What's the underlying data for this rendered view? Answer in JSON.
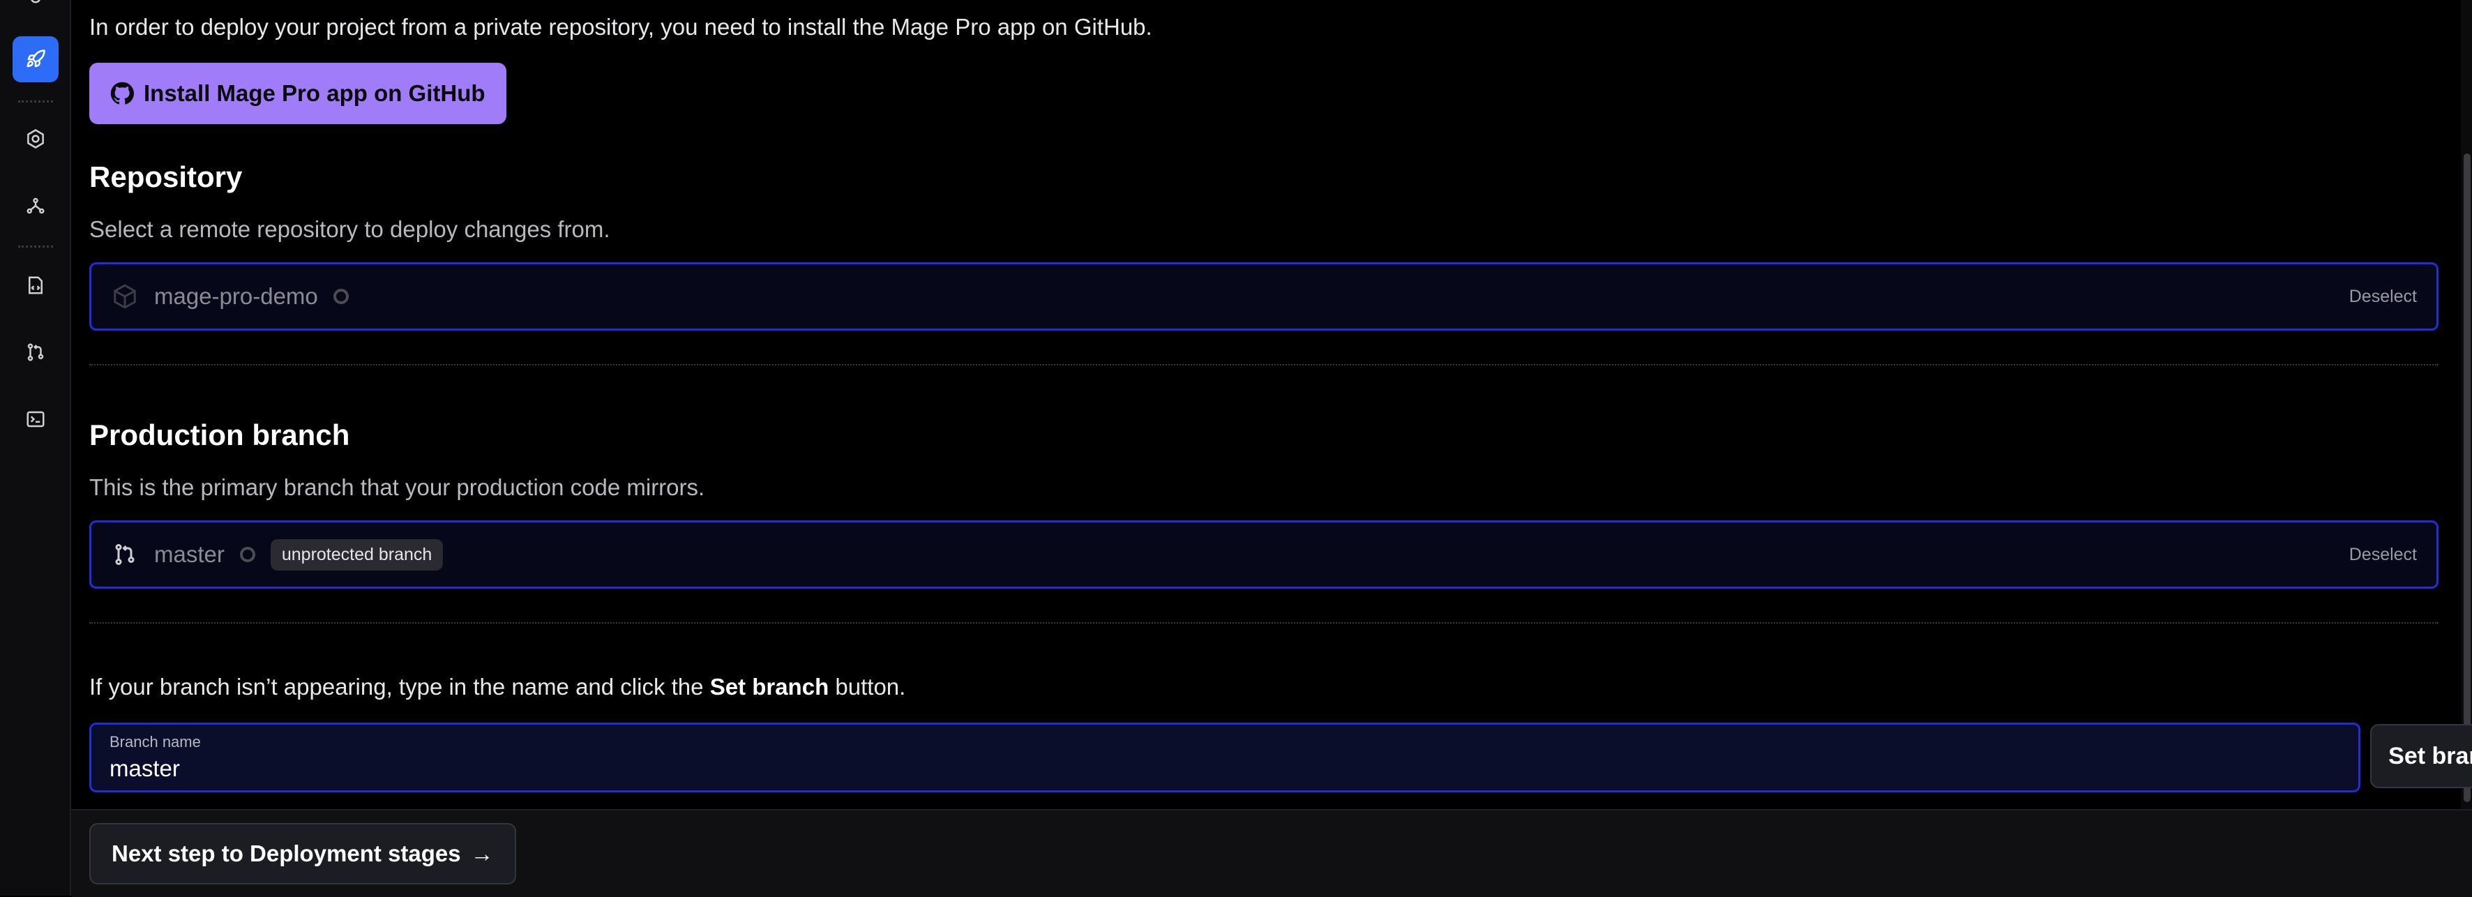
{
  "sidebar": {
    "items": [
      {
        "icon": "rocket-icon",
        "active": true
      },
      {
        "icon": "settings-icon",
        "active": false
      },
      {
        "icon": "nodes-icon",
        "active": false
      },
      {
        "icon": "file-code-icon",
        "active": false
      },
      {
        "icon": "git-branch-icon",
        "active": false
      },
      {
        "icon": "terminal-icon",
        "active": false
      }
    ],
    "accent_color": "#2d6cf6"
  },
  "intro_text": "In order to deploy your project from a private repository, you need to install the Mage Pro app on GitHub.",
  "install_button_label": "Install Mage Pro app on GitHub",
  "repository": {
    "title": "Repository",
    "description": "Select a remote repository to deploy changes from.",
    "selected_name": "mage-pro-demo",
    "deselect_label": "Deselect"
  },
  "production_branch": {
    "title": "Production branch",
    "description": "This is the primary branch that your production code mirrors.",
    "selected_name": "master",
    "badge": "unprotected branch",
    "deselect_label": "Deselect"
  },
  "branch_note": {
    "prefix": "If your branch isn’t appearing, type in the name and click the ",
    "bold": "Set branch",
    "suffix": " button."
  },
  "branch_input": {
    "label": "Branch name",
    "value": "master"
  },
  "set_branch_label": "Set branch",
  "footer": {
    "next_label": "Next step to Deployment stages",
    "next_arrow": "→"
  },
  "colors": {
    "install_button": "#a07cf8",
    "select_border": "#1e2fd8"
  }
}
